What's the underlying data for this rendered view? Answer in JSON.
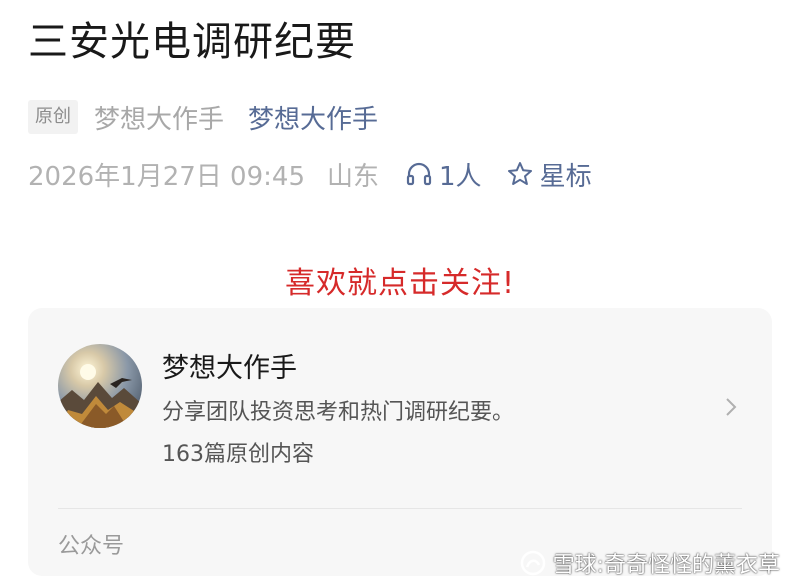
{
  "article": {
    "title": "三安光电调研纪要",
    "original_tag": "原创",
    "author_plain": "梦想大作手",
    "author_link": "梦想大作手",
    "date": "2026年1月27日 09:45",
    "location": "山东",
    "listen_count": "1人",
    "star_label": "星标"
  },
  "follow_prompt": "喜欢就点击关注!",
  "account_card": {
    "name": "梦想大作手",
    "description": "分享团队投资思考和热门调研纪要。",
    "article_count": "163篇原创内容",
    "footer_label": "公众号"
  },
  "watermark": {
    "text": "雪球:奇奇怪怪的薰衣草"
  },
  "icons": {
    "listen": "headphones-icon",
    "star": "star-outline-icon",
    "chevron": "chevron-right-icon",
    "watermark_logo": "xueqiu-logo-icon"
  },
  "colors": {
    "link_blue": "#576b95",
    "prompt_red": "#d62a2a",
    "muted_gray": "#b2b2b2",
    "card_bg": "#f7f7f7"
  }
}
